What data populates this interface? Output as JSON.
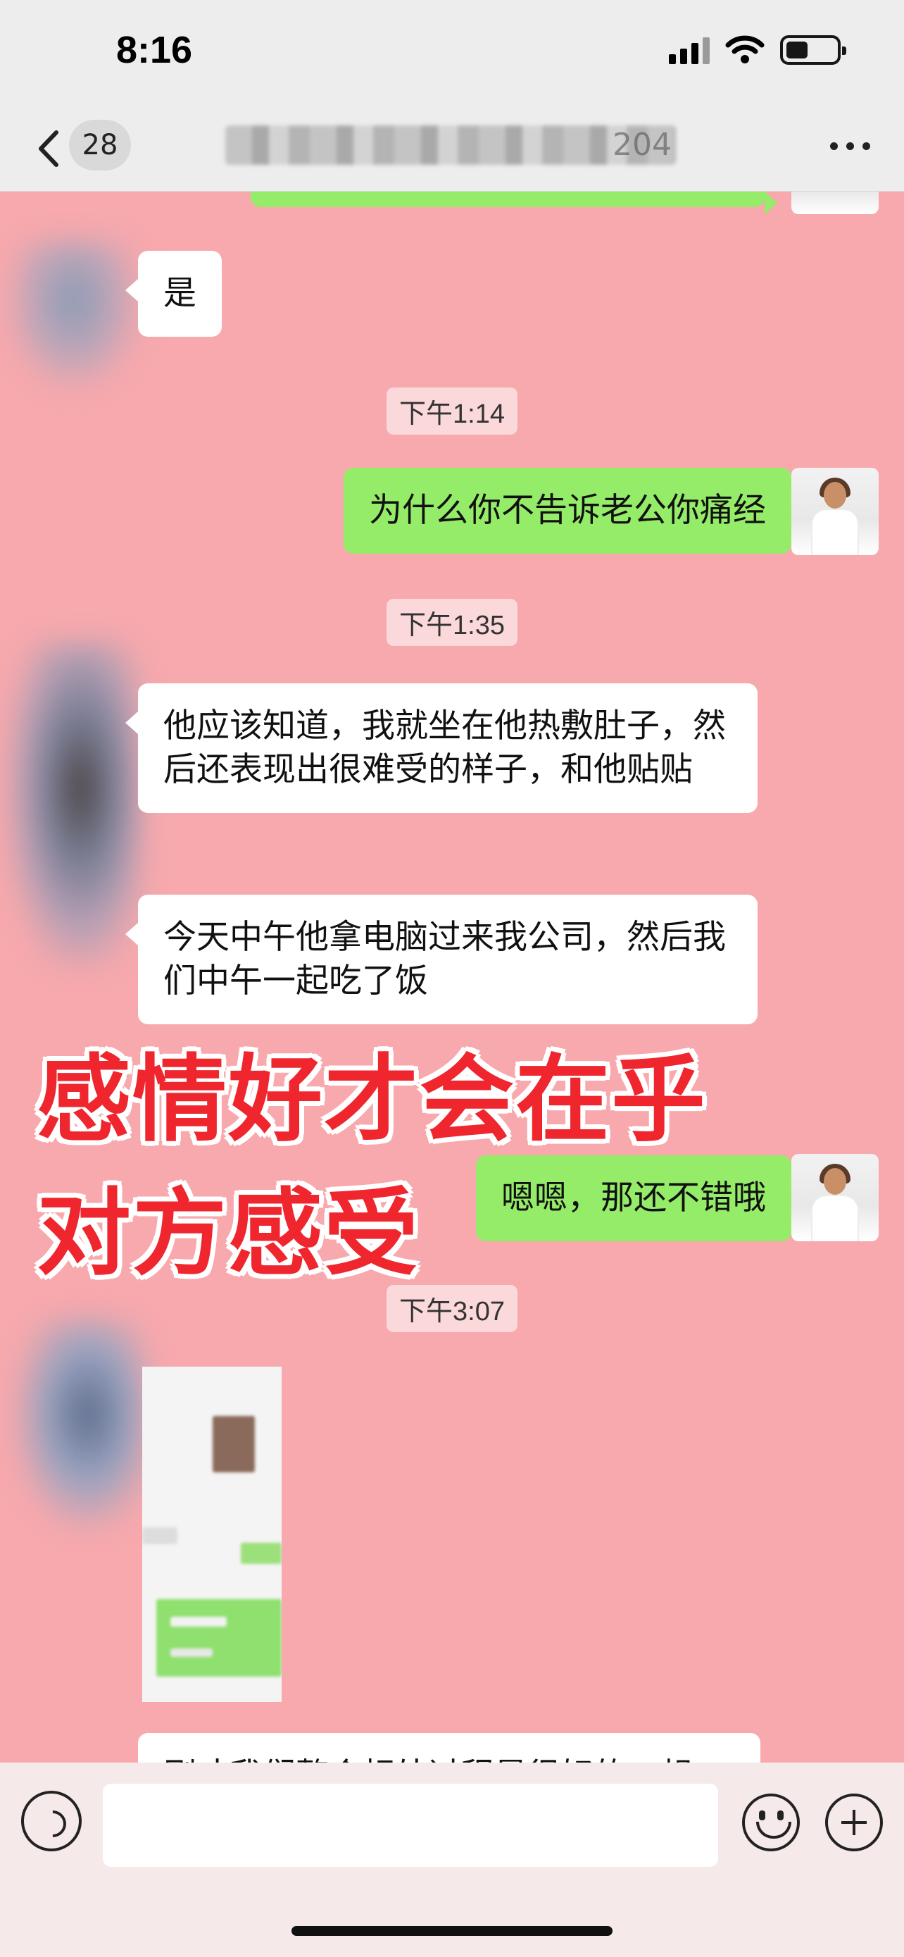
{
  "status_bar": {
    "time": "8:16"
  },
  "nav": {
    "back_count": "28",
    "title_suffix": "204"
  },
  "chat": {
    "messages": [
      {
        "side": "left",
        "text": "是"
      },
      {
        "type": "time",
        "text": "下午1:14"
      },
      {
        "side": "right",
        "text": "为什么你不告诉老公你痛经"
      },
      {
        "type": "time",
        "text": "下午1:35"
      },
      {
        "side": "left",
        "text": "他应该知道，我就坐在他热敷肚子，然后还表现出很难受的样子，和他贴贴"
      },
      {
        "side": "left",
        "text": "今天中午他拿电脑过来我公司，然后我们中午一起吃了饭"
      },
      {
        "side": "right",
        "text": "嗯嗯，那还不错哦"
      },
      {
        "type": "time",
        "text": "下午3:07"
      },
      {
        "side": "left",
        "type": "image",
        "text": ""
      },
      {
        "side": "left",
        "text": "刚才我们整合相处过程是很好的一想"
      }
    ],
    "overlay_caption": [
      "感情好才会在乎",
      "对方感受"
    ]
  },
  "icons": {
    "back": "chevron-left-icon",
    "more": "more-dots-icon",
    "voice": "voice-icon",
    "emoji": "emoji-icon",
    "plus": "plus-icon"
  },
  "colors": {
    "chat_background": "#f7a9ad",
    "bubble_green": "#95ec69",
    "bubble_white": "#ffffff",
    "caption_red": "#f0262f"
  }
}
